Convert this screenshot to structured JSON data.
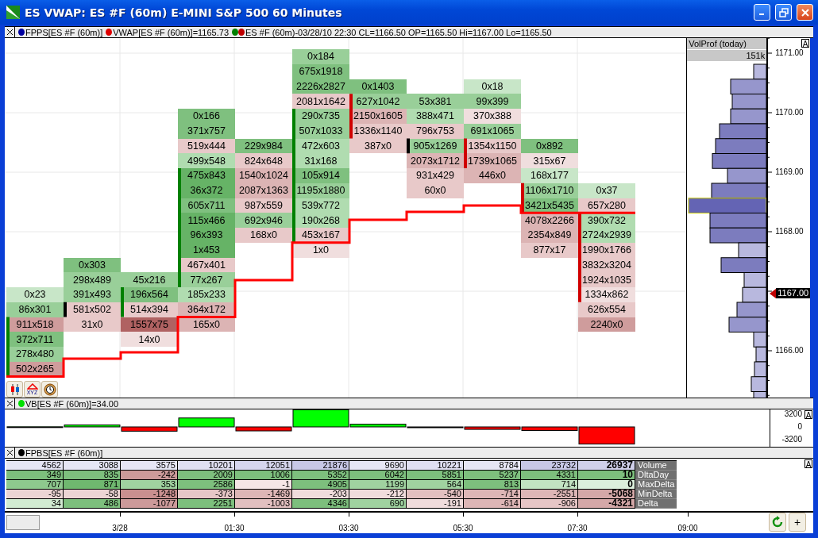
{
  "window": {
    "title": "ES VWAP: ES #F (60m) E-MINI S&P 500 60 Minutes"
  },
  "price_pane": {
    "legend": [
      {
        "text": "FPPS[ES #F (60m)]",
        "dots": [
          {
            "color": "#0000a0"
          }
        ]
      },
      {
        "text": "VWAP[ES #F (60m)]=1165.73",
        "dots": [
          {
            "color": "#e00000"
          }
        ]
      },
      {
        "text": "ES #F (60m)-03/28/10 22:30 CL=1166.50 OP=1165.50 Hi=1167.00 Lo=1165.50",
        "dots": [
          {
            "color": "#008000"
          },
          {
            "color": "#c00000"
          }
        ]
      }
    ],
    "bars": [
      {
        "cells": [
          {
            "text": "0x23",
            "color": "#c8e6c8"
          },
          {
            "text": "86x301",
            "color": "#99cf99"
          },
          {
            "text": "911x518",
            "color": "#cf9c9c"
          },
          {
            "text": "372x711",
            "color": "#7fc07f"
          },
          {
            "text": "278x480",
            "color": "#99cf99"
          },
          {
            "text": "502x265",
            "color": "#cf9c9c"
          }
        ]
      },
      {
        "cells": [
          {
            "text": "0x303",
            "color": "#7fc07f"
          },
          {
            "text": "298x489",
            "color": "#99cf99"
          },
          {
            "text": "391x493",
            "color": "#99cf99"
          },
          {
            "text": "581x502",
            "color": "#e8c9c9"
          },
          {
            "text": "31x0",
            "color": "#e8c9c9"
          }
        ]
      },
      {
        "cells": [
          {
            "text": "45x216",
            "color": "#99cf99"
          },
          {
            "text": "196x564",
            "color": "#7fc07f"
          },
          {
            "text": "514x394",
            "color": "#e8c9c9"
          },
          {
            "text": "1557x75",
            "color": "#b06262"
          },
          {
            "text": "14x0",
            "color": "#f0dede"
          }
        ]
      },
      {
        "cells": [
          {
            "text": "0x166",
            "color": "#7fc07f"
          },
          {
            "text": "371x757",
            "color": "#7fc07f"
          },
          {
            "text": "519x444",
            "color": "#e8c9c9"
          },
          {
            "text": "499x548",
            "color": "#b0dcb0"
          },
          {
            "text": "475x843",
            "color": "#66b366"
          },
          {
            "text": "36x372",
            "color": "#66b366"
          },
          {
            "text": "605x711",
            "color": "#7fc07f"
          },
          {
            "text": "115x466",
            "color": "#66b366"
          },
          {
            "text": "96x393",
            "color": "#66b366"
          },
          {
            "text": "1x453",
            "color": "#66b366"
          },
          {
            "text": "467x401",
            "color": "#e8c9c9"
          },
          {
            "text": "77x267",
            "color": "#99cf99"
          },
          {
            "text": "185x233",
            "color": "#b0dcb0"
          },
          {
            "text": "364x172",
            "color": "#dcb4b4"
          },
          {
            "text": "165x0",
            "color": "#dcb4b4"
          }
        ]
      },
      {
        "cells": [
          {
            "text": "229x984",
            "color": "#7fc07f"
          },
          {
            "text": "824x648",
            "color": "#e8c9c9"
          },
          {
            "text": "1540x1024",
            "color": "#dcb4b4"
          },
          {
            "text": "2087x1363",
            "color": "#dcb4b4"
          },
          {
            "text": "987x559",
            "color": "#e8c9c9"
          },
          {
            "text": "692x946",
            "color": "#99cf99"
          },
          {
            "text": "168x0",
            "color": "#e8c9c9"
          }
        ]
      },
      {
        "cells": [
          {
            "text": "0x184",
            "color": "#99cf99"
          },
          {
            "text": "675x1918",
            "color": "#7fc07f"
          },
          {
            "text": "2226x2827",
            "color": "#7fc07f"
          },
          {
            "text": "2081x1642",
            "color": "#e8c9c9"
          },
          {
            "text": "290x735",
            "color": "#99cf99"
          },
          {
            "text": "507x1033",
            "color": "#99cf99"
          },
          {
            "text": "472x603",
            "color": "#b0dcb0"
          },
          {
            "text": "31x168",
            "color": "#b0dcb0"
          },
          {
            "text": "105x914",
            "color": "#7fc07f"
          },
          {
            "text": "1195x1880",
            "color": "#99cf99"
          },
          {
            "text": "539x772",
            "color": "#b0dcb0"
          },
          {
            "text": "190x268",
            "color": "#b0dcb0"
          },
          {
            "text": "453x167",
            "color": "#e8c9c9"
          },
          {
            "text": "1x0",
            "color": "#f0dede"
          }
        ]
      },
      {
        "cells": [
          {
            "text": "0x1403",
            "color": "#7fc07f"
          },
          {
            "text": "627x1042",
            "color": "#99cf99"
          },
          {
            "text": "2150x1605",
            "color": "#dcb4b4"
          },
          {
            "text": "1336x1140",
            "color": "#e8c9c9"
          },
          {
            "text": "387x0",
            "color": "#e8c9c9"
          }
        ]
      },
      {
        "cells": [
          {
            "text": "53x381",
            "color": "#99cf99"
          },
          {
            "text": "388x471",
            "color": "#b0dcb0"
          },
          {
            "text": "796x753",
            "color": "#e8c9c9"
          },
          {
            "text": "905x1269",
            "color": "#99cf99"
          },
          {
            "text": "2073x1712",
            "color": "#dcb4b4"
          },
          {
            "text": "931x429",
            "color": "#e8c9c9"
          },
          {
            "text": "60x0",
            "color": "#e8c9c9"
          }
        ]
      },
      {
        "cells": [
          {
            "text": "0x18",
            "color": "#c8e6c8"
          },
          {
            "text": "99x399",
            "color": "#99cf99"
          },
          {
            "text": "370x388",
            "color": "#f0dede"
          },
          {
            "text": "691x1065",
            "color": "#99cf99"
          },
          {
            "text": "1354x1150",
            "color": "#e8c9c9"
          },
          {
            "text": "1739x1065",
            "color": "#dcb4b4"
          },
          {
            "text": "446x0",
            "color": "#dcb4b4"
          }
        ]
      },
      {
        "cells": [
          {
            "text": "0x892",
            "color": "#7fc07f"
          },
          {
            "text": "315x67",
            "color": "#f0dede"
          },
          {
            "text": "168x177",
            "color": "#c8e6c8"
          },
          {
            "text": "1106x1710",
            "color": "#99cf99"
          },
          {
            "text": "3421x5435",
            "color": "#7fc07f"
          },
          {
            "text": "4078x2266",
            "color": "#dcb4b4"
          },
          {
            "text": "2354x849",
            "color": "#dcb4b4"
          },
          {
            "text": "877x17",
            "color": "#e8c9c9"
          }
        ]
      },
      {
        "cells": [
          {
            "text": "0x37",
            "color": "#c8e6c8"
          },
          {
            "text": "657x280",
            "color": "#e8c9c9"
          },
          {
            "text": "390x732",
            "color": "#b0dcb0"
          },
          {
            "text": "2724x2939",
            "color": "#b0dcb0"
          },
          {
            "text": "1990x1766",
            "color": "#e8c9c9"
          },
          {
            "text": "3832x3204",
            "color": "#e8c9c9"
          },
          {
            "text": "1924x1035",
            "color": "#e8c9c9"
          },
          {
            "text": "1334x862",
            "color": "#f0dede"
          },
          {
            "text": "626x554",
            "color": "#e8c9c9"
          },
          {
            "text": "2240x0",
            "color": "#cf9c9c"
          }
        ]
      }
    ],
    "tools": [
      {
        "kind": "candles"
      },
      {
        "kind": "draw",
        "label": "XYZ"
      },
      {
        "kind": "clock"
      }
    ],
    "volume_profile": {
      "title": "VolProf (today)",
      "total": "151k"
    },
    "price_labels": [
      "1171.00",
      "1170.00",
      "1169.00",
      "1168.00",
      "1166.00"
    ],
    "current_price": "1167.00",
    "scale_button": "A"
  },
  "vb_pane": {
    "legend": {
      "text": "VB[ES #F (60m)]=34.00",
      "dots": [
        {
          "color": "#00e000"
        }
      ]
    },
    "axis_labels": [
      "3200",
      "0",
      "-3200"
    ],
    "scale_button": "A"
  },
  "table_pane": {
    "legend": {
      "text": "FPBS[ES #F (60m)]",
      "dots": [
        {
          "color": "#000000"
        }
      ]
    },
    "rows": [
      {
        "label": "Volume",
        "cells": [
          {
            "text": "4562",
            "color": "#e6e6f5"
          },
          {
            "text": "3088",
            "color": "#e6e6f5"
          },
          {
            "text": "3575",
            "color": "#e6e6f5"
          },
          {
            "text": "10201",
            "color": "#e0e0f2"
          },
          {
            "text": "12051",
            "color": "#d6d6ee"
          },
          {
            "text": "21876",
            "color": "#c8c8e6"
          },
          {
            "text": "9690",
            "color": "#e6e6f5"
          },
          {
            "text": "10221",
            "color": "#e0e0f2"
          },
          {
            "text": "8784",
            "color": "#e6e6f5"
          },
          {
            "text": "23732",
            "color": "#c8c8e6"
          },
          {
            "text": "26937",
            "color": "#d0d0ea"
          }
        ]
      },
      {
        "label": "DltaDay",
        "cells": [
          {
            "text": "349",
            "color": "#7dbf7d"
          },
          {
            "text": "835",
            "color": "#7dbf7d"
          },
          {
            "text": "-242",
            "color": "#cc9a9a"
          },
          {
            "text": "2009",
            "color": "#7dbf7d"
          },
          {
            "text": "1006",
            "color": "#7dbf7d"
          },
          {
            "text": "5352",
            "color": "#7dbf7d"
          },
          {
            "text": "6042",
            "color": "#7dbf7d"
          },
          {
            "text": "5851",
            "color": "#7dbf7d"
          },
          {
            "text": "5237",
            "color": "#7dbf7d"
          },
          {
            "text": "4331",
            "color": "#7dbf7d"
          },
          {
            "text": "10",
            "color": "#7dbf7d"
          }
        ]
      },
      {
        "label": "MaxDelta",
        "cells": [
          {
            "text": "707",
            "color": "#8ec98e"
          },
          {
            "text": "871",
            "color": "#6fb86f"
          },
          {
            "text": "353",
            "color": "#a0d2a0"
          },
          {
            "text": "2586",
            "color": "#7dbf7d"
          },
          {
            "text": "-1",
            "color": "#f5e6e6"
          },
          {
            "text": "4905",
            "color": "#7dbf7d"
          },
          {
            "text": "1199",
            "color": "#a0d2a0"
          },
          {
            "text": "564",
            "color": "#a0d2a0"
          },
          {
            "text": "813",
            "color": "#7dbf7d"
          },
          {
            "text": "714",
            "color": "#c2e3c2"
          },
          {
            "text": "0",
            "color": "#dcefdc"
          }
        ]
      },
      {
        "label": "MinDelta",
        "cells": [
          {
            "text": "-95",
            "color": "#ecd4d4"
          },
          {
            "text": "-58",
            "color": "#ecd4d4"
          },
          {
            "text": "-1248",
            "color": "#c98f8f"
          },
          {
            "text": "-373",
            "color": "#e6c6c6"
          },
          {
            "text": "-1469",
            "color": "#ddb6b6"
          },
          {
            "text": "-203",
            "color": "#f0dcdc"
          },
          {
            "text": "-212",
            "color": "#f0dcdc"
          },
          {
            "text": "-540",
            "color": "#e2bfbf"
          },
          {
            "text": "-714",
            "color": "#ddb6b6"
          },
          {
            "text": "-2551",
            "color": "#ddb6b6"
          },
          {
            "text": "-5068",
            "color": "#d4a8a8"
          }
        ]
      },
      {
        "label": "Delta",
        "cells": [
          {
            "text": "34",
            "color": "#d2ebd2"
          },
          {
            "text": "486",
            "color": "#7dbf7d"
          },
          {
            "text": "-1077",
            "color": "#cc9a9a"
          },
          {
            "text": "2251",
            "color": "#7dbf7d"
          },
          {
            "text": "-1003",
            "color": "#e2c0c0"
          },
          {
            "text": "4346",
            "color": "#7dbf7d"
          },
          {
            "text": "690",
            "color": "#a0d2a0"
          },
          {
            "text": "-191",
            "color": "#f0dcdc"
          },
          {
            "text": "-614",
            "color": "#ddb6b6"
          },
          {
            "text": "-906",
            "color": "#e6c6c6"
          },
          {
            "text": "-4321",
            "color": "#d4a8a8"
          }
        ]
      }
    ],
    "scale_button": "A"
  },
  "time_axis": {
    "labels": [
      "3/28",
      "01:30",
      "03:30",
      "05:30",
      "07:30",
      "09:00"
    ]
  },
  "zoom_button": "+"
}
